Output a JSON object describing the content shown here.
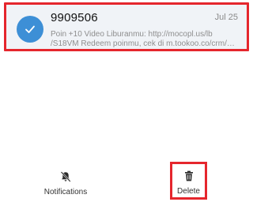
{
  "message": {
    "sender": "9909506",
    "date": "Jul 25",
    "preview_line1": "Poin +10  Video Liburanmu: http://mocopl.us/lb",
    "preview_line2": "/S18VM Redeem poinmu, cek di m.tookoo.co/crm/…",
    "selected_icon": "check-icon",
    "accent_color": "#3d8fd6",
    "highlight_color": "#e5262d"
  },
  "bottom_bar": {
    "notifications": {
      "label": "Notifications",
      "icon": "bell-off-icon"
    },
    "delete": {
      "label": "Delete",
      "icon": "trash-icon"
    }
  }
}
